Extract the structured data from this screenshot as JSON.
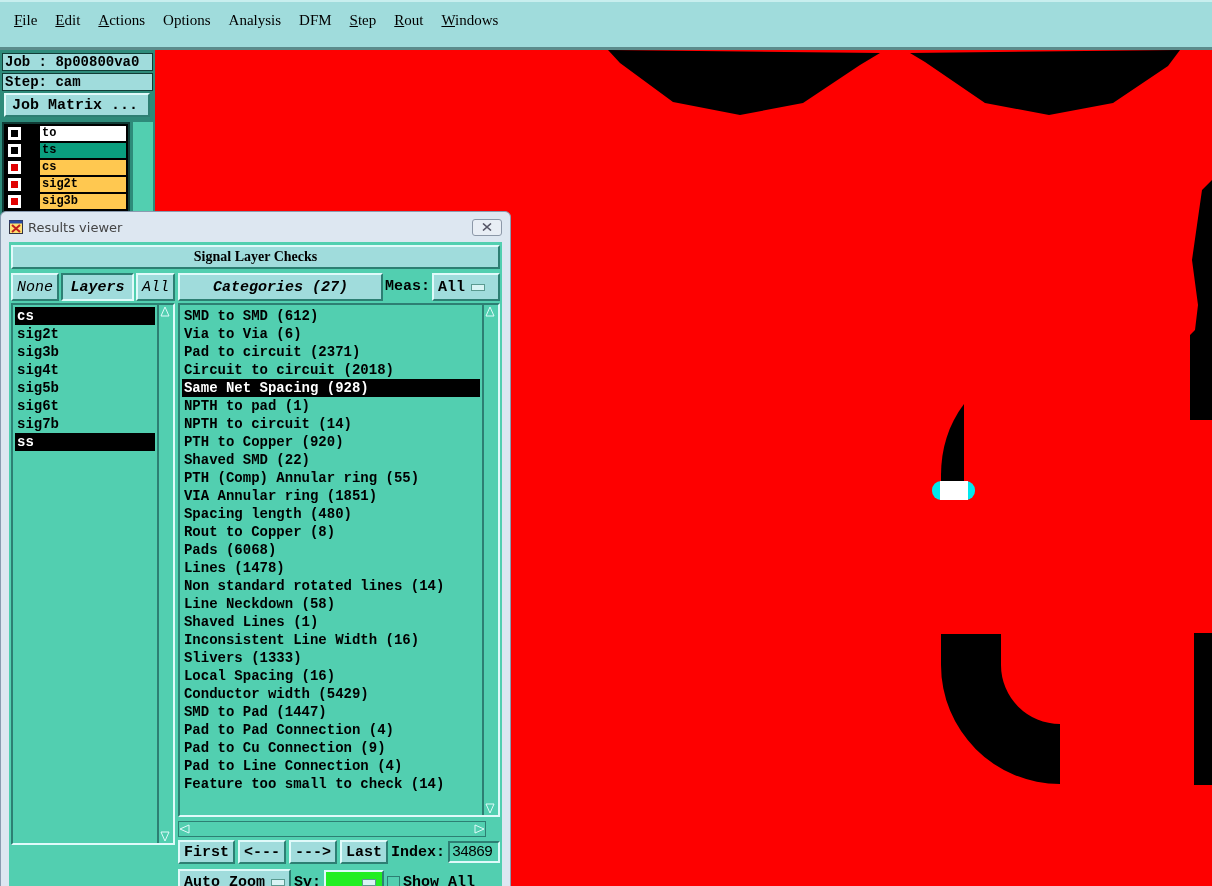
{
  "menu": [
    {
      "label": "File",
      "underlined": true
    },
    {
      "label": "Edit",
      "underlined": true
    },
    {
      "label": "Actions",
      "underlined": true
    },
    {
      "label": "Options",
      "underlined": false
    },
    {
      "label": "Analysis",
      "underlined": false
    },
    {
      "label": "DFM",
      "underlined": false
    },
    {
      "label": "Step",
      "underlined": true
    },
    {
      "label": "Rout",
      "underlined": true
    },
    {
      "label": "Windows",
      "underlined": true
    }
  ],
  "job_panel": {
    "job": "Job : 8p00800va0",
    "step": "Step: cam",
    "matrix_button": "Job Matrix ...",
    "layers": [
      {
        "name": "to",
        "checked": false,
        "color": "#ffffff"
      },
      {
        "name": "ts",
        "checked": false,
        "color": "#0a9e7e"
      },
      {
        "name": "cs",
        "checked": true,
        "color": "#ffc850"
      },
      {
        "name": "sig2t",
        "checked": true,
        "color": "#ffc850"
      },
      {
        "name": "sig3b",
        "checked": true,
        "color": "#ffc850"
      }
    ]
  },
  "results_viewer": {
    "title": "Results viewer",
    "header": "Signal Layer Checks",
    "none_button": "None",
    "layers_label": "Layers",
    "all_button": "All",
    "layers": [
      {
        "name": "cs",
        "selected": true
      },
      {
        "name": "sig2t",
        "selected": false
      },
      {
        "name": "sig3b",
        "selected": false
      },
      {
        "name": "sig4t",
        "selected": false
      },
      {
        "name": "sig5b",
        "selected": false
      },
      {
        "name": "sig6t",
        "selected": false
      },
      {
        "name": "sig7b",
        "selected": false
      },
      {
        "name": "ss",
        "selected": true
      }
    ],
    "categories_button": "Categories (27)",
    "meas_label": "Meas:",
    "meas_value": "All",
    "categories": [
      {
        "label": "SMD to SMD (612)",
        "selected": false
      },
      {
        "label": "Via to Via (6)",
        "selected": false
      },
      {
        "label": "Pad to circuit (2371)",
        "selected": false
      },
      {
        "label": "Circuit to circuit (2018)",
        "selected": false
      },
      {
        "label": "Same Net Spacing (928)",
        "selected": true
      },
      {
        "label": "NPTH to pad (1)",
        "selected": false
      },
      {
        "label": "NPTH to circuit (14)",
        "selected": false
      },
      {
        "label": "PTH to Copper (920)",
        "selected": false
      },
      {
        "label": "Shaved SMD (22)",
        "selected": false
      },
      {
        "label": "PTH (Comp) Annular ring (55)",
        "selected": false
      },
      {
        "label": "VIA Annular ring (1851)",
        "selected": false
      },
      {
        "label": "Spacing length (480)",
        "selected": false
      },
      {
        "label": "Rout to Copper (8)",
        "selected": false
      },
      {
        "label": "Pads (6068)",
        "selected": false
      },
      {
        "label": "Lines (1478)",
        "selected": false
      },
      {
        "label": "Non standard rotated lines (14)",
        "selected": false
      },
      {
        "label": "Line Neckdown (58)",
        "selected": false
      },
      {
        "label": "Shaved Lines (1)",
        "selected": false
      },
      {
        "label": "Inconsistent Line Width (16)",
        "selected": false
      },
      {
        "label": "Slivers (1333)",
        "selected": false
      },
      {
        "label": "Local Spacing (16)",
        "selected": false
      },
      {
        "label": "Conductor width (5429)",
        "selected": false
      },
      {
        "label": "SMD to Pad (1447)",
        "selected": false
      },
      {
        "label": "Pad to Pad Connection (4)",
        "selected": false
      },
      {
        "label": "Pad to Cu Connection (9)",
        "selected": false
      },
      {
        "label": "Pad to Line Connection (4)",
        "selected": false
      },
      {
        "label": "Feature too small to check (14)",
        "selected": false
      }
    ],
    "nav_buttons": [
      "First",
      "<---",
      "--->",
      "Last"
    ],
    "index_label": "Index:",
    "index_value": "34869",
    "zoom_mode": "Auto Zoom",
    "sv_label": "Sv:",
    "show_all": {
      "label": "Show All",
      "checked": false
    }
  }
}
